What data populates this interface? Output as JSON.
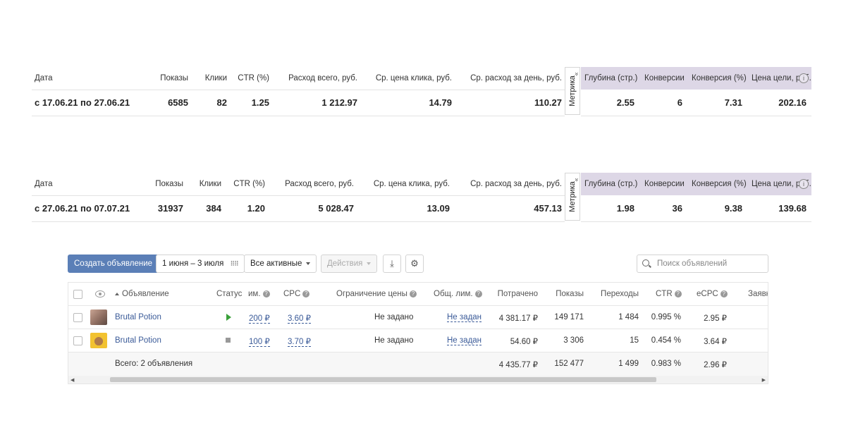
{
  "stats1": {
    "headers": [
      "Дата",
      "Показы",
      "Клики",
      "CTR (%)",
      "Расход всего, руб.",
      "Ср. цена клика, руб.",
      "Ср. расход за день, руб."
    ],
    "values": [
      "с 17.06.21 по 27.06.21",
      "6585",
      "82",
      "1.25",
      "1 212.97",
      "14.79",
      "110.27"
    ],
    "metrika_label": "Метрика",
    "right_headers": [
      "Глубина (стр.)",
      "Конверсии",
      "Конверсия (%)",
      "Цена цели, руб."
    ],
    "right_values": [
      "2.55",
      "6",
      "7.31",
      "202.16"
    ]
  },
  "stats2": {
    "headers": [
      "Дата",
      "Показы",
      "Клики",
      "CTR (%)",
      "Расход всего, руб.",
      "Ср. цена клика, руб.",
      "Ср. расход за день, руб."
    ],
    "values": [
      "с 27.06.21 по 07.07.21",
      "31937",
      "384",
      "1.20",
      "5 028.47",
      "13.09",
      "457.13"
    ],
    "metrika_label": "Метрика",
    "right_headers": [
      "Глубина (стр.)",
      "Конверсии",
      "Конверсия (%)",
      "Цена цели, руб."
    ],
    "right_values": [
      "1.98",
      "36",
      "9.38",
      "139.68"
    ]
  },
  "toolbar": {
    "create_label": "Создать объявление",
    "date_range": "1 июня – 3 июля",
    "filter_label": "Все активные",
    "actions_label": "Действия",
    "search_placeholder": "Поиск объявлений"
  },
  "grid": {
    "headers": {
      "ad": "Объявление",
      "status": "Статус",
      "lim": "им.",
      "cpc": "CPC",
      "price_limit": "Ограничение цены",
      "common_lim": "Общ. лим.",
      "spent": "Потрачено",
      "impressions": "Показы",
      "clicks": "Переходы",
      "ctr": "CTR",
      "ecpc": "eCPC",
      "requests": "Заявк"
    },
    "rows": [
      {
        "name": "Brutal Potion",
        "status": "active",
        "lim": "200 ₽",
        "cpc": "3.60 ₽",
        "price_limit": "Не задано",
        "common_lim": "Не задан",
        "spent": "4 381.17 ₽",
        "impressions": "149 171",
        "clicks": "1 484",
        "ctr": "0.995 %",
        "ecpc": "2.95 ₽"
      },
      {
        "name": "Brutal Potion",
        "status": "stopped",
        "lim": "100 ₽",
        "cpc": "3.70 ₽",
        "price_limit": "Не задано",
        "common_lim": "Не задан",
        "spent": "54.60 ₽",
        "impressions": "3 306",
        "clicks": "15",
        "ctr": "0.454 %",
        "ecpc": "3.64 ₽"
      }
    ],
    "total": {
      "label": "Всего: 2 объявления",
      "spent": "4 435.77 ₽",
      "impressions": "152 477",
      "clicks": "1 499",
      "ctr": "0.983 %",
      "ecpc": "2.96 ₽"
    }
  }
}
